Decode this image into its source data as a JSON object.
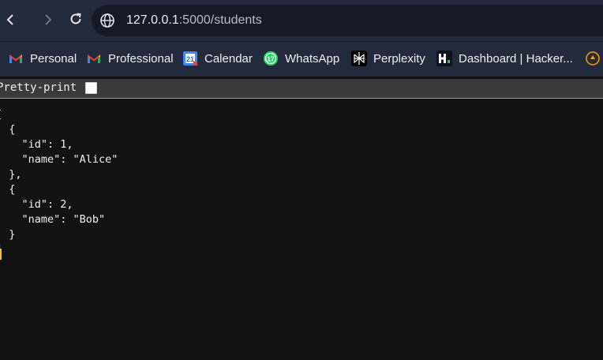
{
  "browser": {
    "url_host": "127.0.0.1",
    "url_path": ":5000/students",
    "back_icon": "‹",
    "forward_icon": "›",
    "reload_icon": "↻"
  },
  "bookmarks": [
    {
      "label": "Personal",
      "icon": "gmail-icon"
    },
    {
      "label": "Professional",
      "icon": "gmail-icon"
    },
    {
      "label": "Calendar",
      "icon": "calendar-icon",
      "icon_text": "21"
    },
    {
      "label": "WhatsApp",
      "icon": "whatsapp-icon",
      "icon_text": "17"
    },
    {
      "label": "Perplexity",
      "icon": "perplexity-icon"
    },
    {
      "label": "Dashboard | Hacker...",
      "icon": "hackerrank-icon",
      "icon_text": "H"
    }
  ],
  "pretty_print": {
    "label": "Pretty-print",
    "checked": false
  },
  "json_text": "[\n  {\n    \"id\": 1,\n    \"name\": \"Alice\"\n  },\n  {\n    \"id\": 2,\n    \"name\": \"Bob\"\n  }\n]",
  "colors": {
    "toolbar_bg": "#232a3b",
    "omnibox_bg": "#141a27",
    "page_bg": "#121212",
    "caret": "#f0c32a"
  }
}
